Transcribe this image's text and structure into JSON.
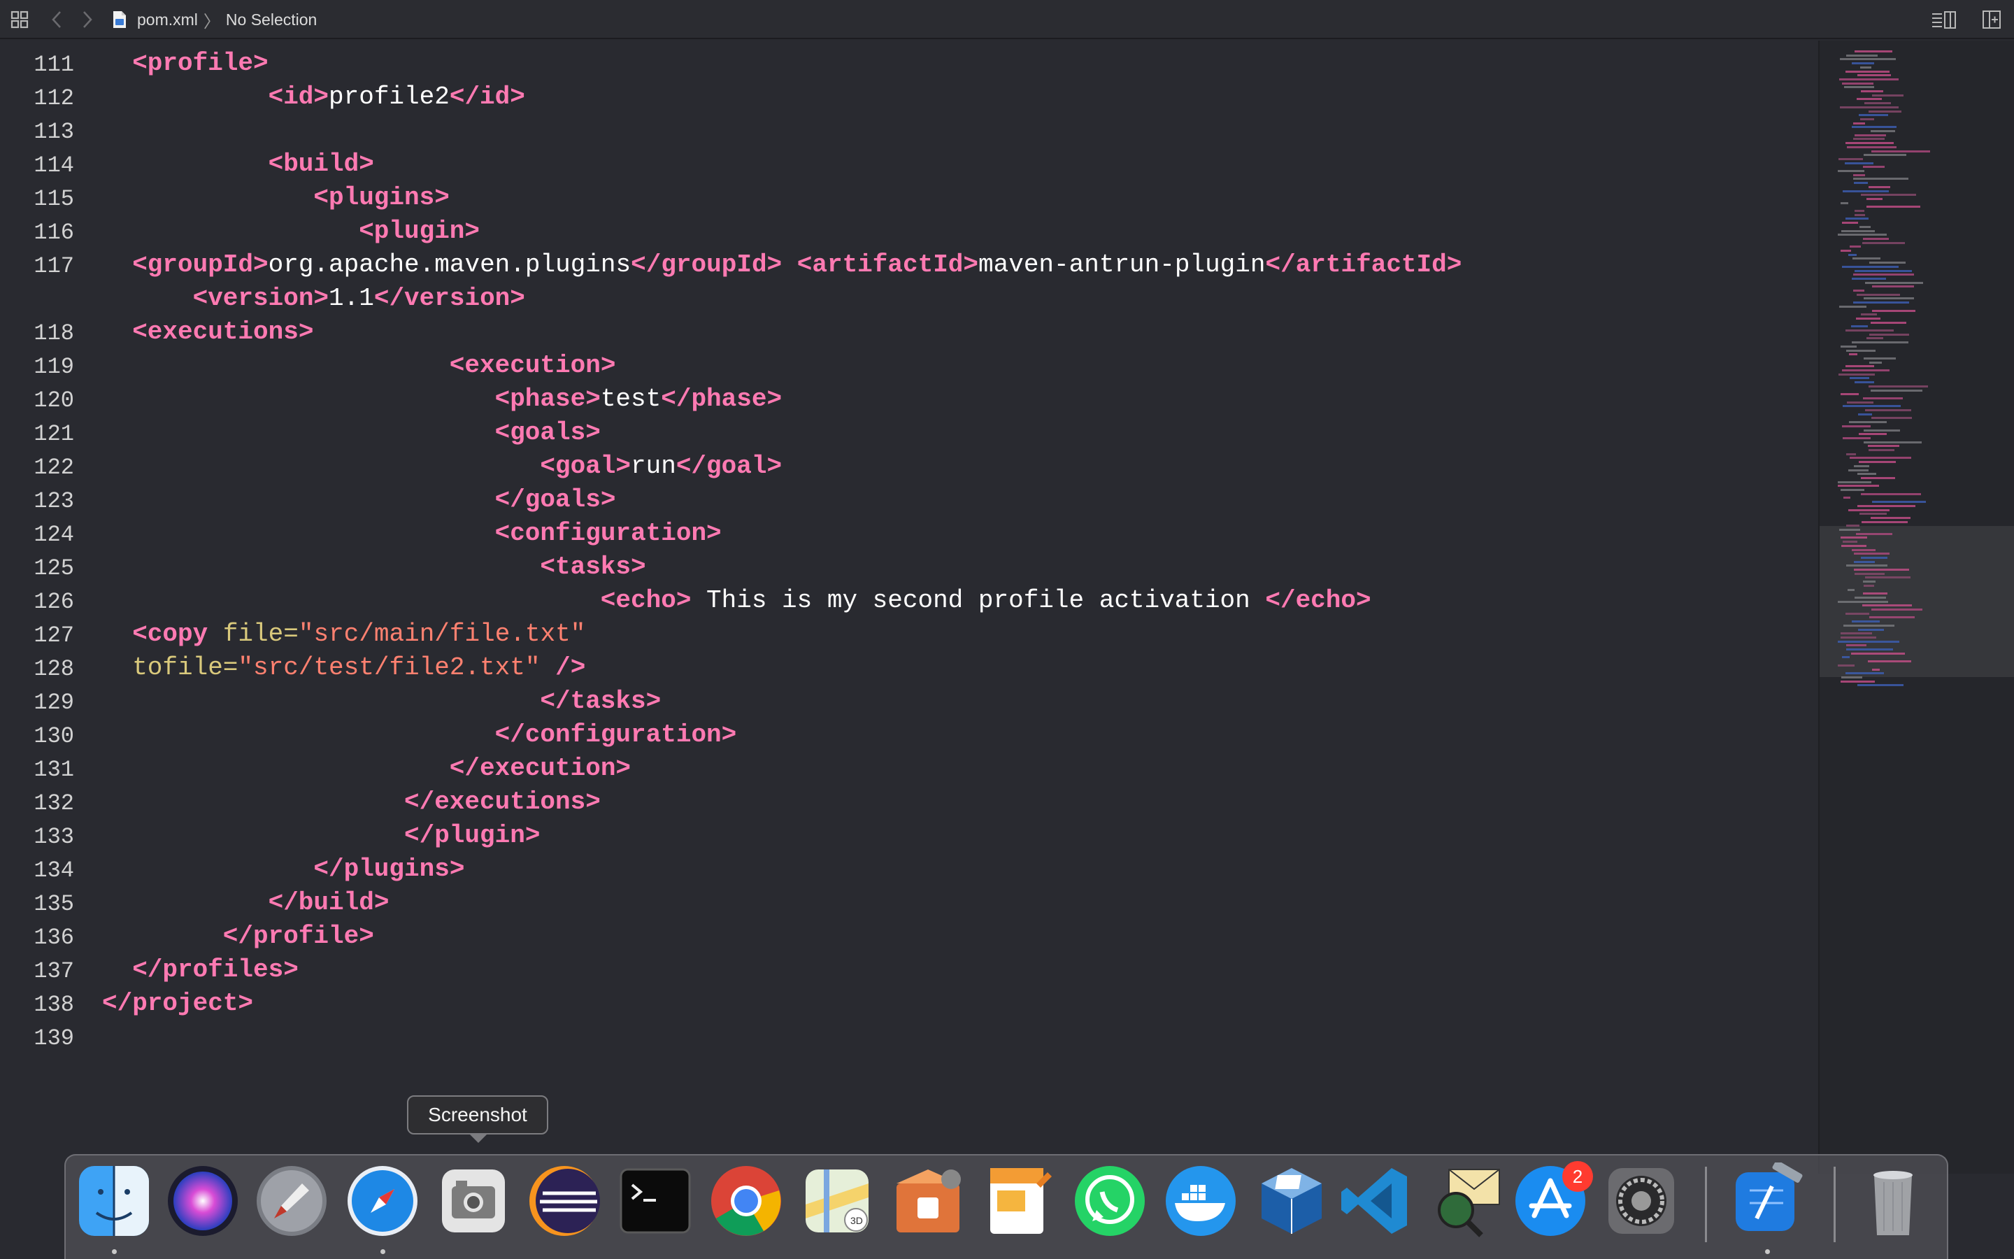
{
  "breadcrumb": {
    "file": "pom.xml",
    "separator": "〉",
    "selection": "No Selection"
  },
  "editor": {
    "lines": [
      {
        "n": "111",
        "indent": 2,
        "tokens": [
          [
            "tag",
            "<profile>"
          ]
        ]
      },
      {
        "n": "112",
        "indent": 11,
        "tokens": [
          [
            "tag",
            "<id>"
          ],
          [
            "txt",
            "profile2"
          ],
          [
            "tag",
            "</id>"
          ]
        ]
      },
      {
        "n": "113",
        "indent": 0,
        "tokens": []
      },
      {
        "n": "114",
        "indent": 11,
        "tokens": [
          [
            "tag",
            "<build>"
          ]
        ]
      },
      {
        "n": "115",
        "indent": 14,
        "tokens": [
          [
            "tag",
            "<plugins>"
          ]
        ]
      },
      {
        "n": "116",
        "indent": 17,
        "tokens": [
          [
            "tag",
            "<plugin>"
          ]
        ]
      },
      {
        "n": "117",
        "indent": 2,
        "tokens": [
          [
            "tag",
            "<groupId>"
          ],
          [
            "txt",
            "org.apache.maven.plugins"
          ],
          [
            "tag",
            "</groupId>"
          ],
          [
            "txt",
            " "
          ],
          [
            "tag",
            "<artifactId>"
          ],
          [
            "txt",
            "maven-antrun-plugin"
          ],
          [
            "tag",
            "</artifactId>"
          ]
        ]
      },
      {
        "n": "",
        "indent": 6,
        "tokens": [
          [
            "tag",
            "<version>"
          ],
          [
            "txt",
            "1.1"
          ],
          [
            "tag",
            "</version>"
          ]
        ]
      },
      {
        "n": "118",
        "indent": 2,
        "tokens": [
          [
            "tag",
            "<executions>"
          ]
        ]
      },
      {
        "n": "119",
        "indent": 23,
        "tokens": [
          [
            "tag",
            "<execution>"
          ]
        ]
      },
      {
        "n": "120",
        "indent": 26,
        "tokens": [
          [
            "tag",
            "<phase>"
          ],
          [
            "txt",
            "test"
          ],
          [
            "tag",
            "</phase>"
          ]
        ]
      },
      {
        "n": "121",
        "indent": 26,
        "tokens": [
          [
            "tag",
            "<goals>"
          ]
        ]
      },
      {
        "n": "122",
        "indent": 29,
        "tokens": [
          [
            "tag",
            "<goal>"
          ],
          [
            "txt",
            "run"
          ],
          [
            "tag",
            "</goal>"
          ]
        ]
      },
      {
        "n": "123",
        "indent": 26,
        "tokens": [
          [
            "tag",
            "</goals>"
          ]
        ]
      },
      {
        "n": "124",
        "indent": 26,
        "tokens": [
          [
            "tag",
            "<configuration>"
          ]
        ]
      },
      {
        "n": "125",
        "indent": 29,
        "tokens": [
          [
            "tag",
            "<tasks>"
          ]
        ]
      },
      {
        "n": "126",
        "indent": 33,
        "tokens": [
          [
            "tag",
            "<echo>"
          ],
          [
            "txt",
            " This is my second profile activation "
          ],
          [
            "tag",
            "</echo>"
          ]
        ]
      },
      {
        "n": "127",
        "indent": 2,
        "tokens": [
          [
            "tag",
            "<copy"
          ],
          [
            "txt",
            " "
          ],
          [
            "attr",
            "file="
          ],
          [
            "str",
            "\"src/main/file.txt\""
          ]
        ]
      },
      {
        "n": "128",
        "indent": 2,
        "tokens": [
          [
            "attr",
            "tofile="
          ],
          [
            "str",
            "\"src/test/file2.txt\""
          ],
          [
            "txt",
            " "
          ],
          [
            "tag",
            "/>"
          ]
        ]
      },
      {
        "n": "129",
        "indent": 29,
        "tokens": [
          [
            "tag",
            "</tasks>"
          ]
        ]
      },
      {
        "n": "130",
        "indent": 26,
        "tokens": [
          [
            "tag",
            "</configuration>"
          ]
        ]
      },
      {
        "n": "131",
        "indent": 23,
        "tokens": [
          [
            "tag",
            "</execution>"
          ]
        ]
      },
      {
        "n": "132",
        "indent": 20,
        "tokens": [
          [
            "tag",
            "</executions>"
          ]
        ]
      },
      {
        "n": "133",
        "indent": 20,
        "tokens": [
          [
            "tag",
            "</plugin>"
          ]
        ]
      },
      {
        "n": "134",
        "indent": 14,
        "tokens": [
          [
            "tag",
            "</plugins>"
          ]
        ]
      },
      {
        "n": "135",
        "indent": 11,
        "tokens": [
          [
            "tag",
            "</build>"
          ]
        ]
      },
      {
        "n": "136",
        "indent": 8,
        "tokens": [
          [
            "tag",
            "</profile>"
          ]
        ]
      },
      {
        "n": "137",
        "indent": 2,
        "tokens": [
          [
            "tag",
            "</profiles>"
          ]
        ]
      },
      {
        "n": "138",
        "indent": 0,
        "tokens": [
          [
            "tag",
            "</project>"
          ]
        ]
      },
      {
        "n": "139",
        "indent": 0,
        "tokens": []
      }
    ]
  },
  "colors": {
    "tag": "#ff7ab2",
    "attr": "#d9c97c",
    "string": "#ff8170",
    "text": "#ffffff",
    "background": "#292a30"
  },
  "dock": {
    "tooltip": "Screenshot",
    "apps": [
      {
        "name": "Finder",
        "icon": "finder-icon",
        "running": true
      },
      {
        "name": "Siri",
        "icon": "siri-icon",
        "running": false
      },
      {
        "name": "Launchpad",
        "icon": "rocket-icon",
        "running": false
      },
      {
        "name": "Safari",
        "icon": "compass-icon",
        "running": true
      },
      {
        "name": "Screenshot",
        "icon": "screenshot-icon",
        "running": false
      },
      {
        "name": "Eclipse",
        "icon": "eclipse-icon",
        "running": false
      },
      {
        "name": "Terminal",
        "icon": "terminal-icon",
        "running": false
      },
      {
        "name": "Google Chrome",
        "icon": "chrome-icon",
        "running": false
      },
      {
        "name": "Maps",
        "icon": "maps-icon",
        "running": false
      },
      {
        "name": "XAMPP",
        "icon": "xampp-icon",
        "running": false
      },
      {
        "name": "Pages",
        "icon": "pages-icon",
        "running": false
      },
      {
        "name": "WhatsApp",
        "icon": "whatsapp-icon",
        "running": false
      },
      {
        "name": "Docker",
        "icon": "docker-icon",
        "running": false
      },
      {
        "name": "VirtualBox",
        "icon": "virtualbox-icon",
        "running": false
      },
      {
        "name": "Visual Studio Code",
        "icon": "vscode-icon",
        "running": false
      },
      {
        "name": "Mail Viewer",
        "icon": "mail-magnifier-icon",
        "running": false
      },
      {
        "name": "App Store",
        "icon": "app-store-icon",
        "running": false,
        "badge": "2"
      },
      {
        "name": "System Preferences",
        "icon": "gear-icon",
        "running": false
      },
      {
        "name": "Xcode",
        "icon": "xcode-icon",
        "running": true
      },
      {
        "name": "Trash",
        "icon": "trash-icon",
        "running": false
      }
    ]
  }
}
